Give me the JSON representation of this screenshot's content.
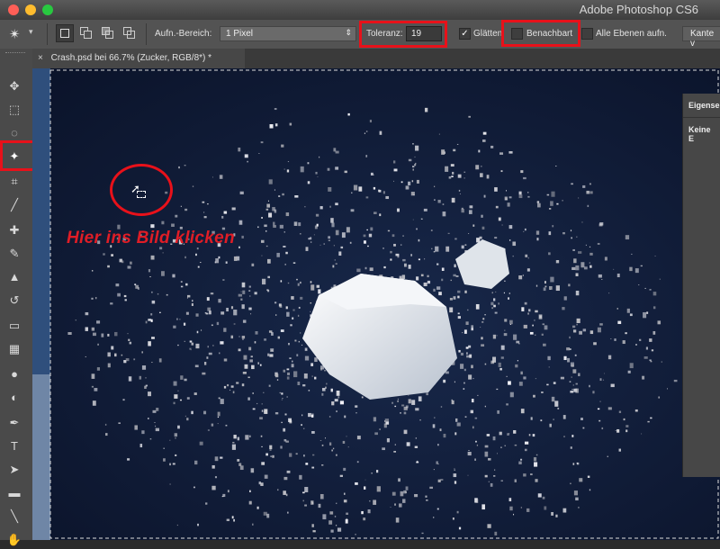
{
  "window": {
    "app_title": "Adobe Photoshop CS6",
    "colors": {
      "titlebar": "#4a4a4a",
      "optionsbar": "#535353",
      "canvas_bg": "#0f1a33",
      "highlight": "#e8111a"
    }
  },
  "options_bar": {
    "tool_icon": "magic-wand-icon",
    "sample_size_label": "Aufn.-Bereich:",
    "sample_size_value": "1 Pixel",
    "tolerance_label": "Toleranz:",
    "tolerance_value": "19",
    "antialias_label": "Glätten",
    "antialias_checked": true,
    "contiguous_label": "Benachbart",
    "contiguous_checked": false,
    "all_layers_label": "Alle Ebenen aufn.",
    "all_layers_checked": false,
    "refine_edge_label": "Kante v"
  },
  "document": {
    "tab_title": "Crash.psd bei 66.7% (Zucker, RGB/8*) *"
  },
  "panel": {
    "title": "Eigense",
    "content": "Keine E"
  },
  "annotation": {
    "instruction": "Hier ins Bild klicken"
  },
  "tools": [
    {
      "name": "move-tool",
      "glyph": "✥"
    },
    {
      "name": "marquee-tool",
      "glyph": "⬚"
    },
    {
      "name": "lasso-tool",
      "glyph": "◌"
    },
    {
      "name": "magic-wand-tool",
      "glyph": "✦"
    },
    {
      "name": "crop-tool",
      "glyph": "⌗"
    },
    {
      "name": "eyedropper-tool",
      "glyph": "╱"
    },
    {
      "name": "healing-tool",
      "glyph": "✚"
    },
    {
      "name": "brush-tool",
      "glyph": "✎"
    },
    {
      "name": "stamp-tool",
      "glyph": "▲"
    },
    {
      "name": "history-brush-tool",
      "glyph": "↺"
    },
    {
      "name": "eraser-tool",
      "glyph": "▭"
    },
    {
      "name": "gradient-tool",
      "glyph": "▦"
    },
    {
      "name": "blur-tool",
      "glyph": "●"
    },
    {
      "name": "dodge-tool",
      "glyph": "◐"
    },
    {
      "name": "pen-tool",
      "glyph": "✒"
    },
    {
      "name": "type-tool",
      "glyph": "T"
    },
    {
      "name": "path-selection-tool",
      "glyph": "➤"
    },
    {
      "name": "shape-tool",
      "glyph": "▬"
    },
    {
      "name": "line-tool",
      "glyph": "╲"
    },
    {
      "name": "hand-tool",
      "glyph": "✋"
    }
  ]
}
